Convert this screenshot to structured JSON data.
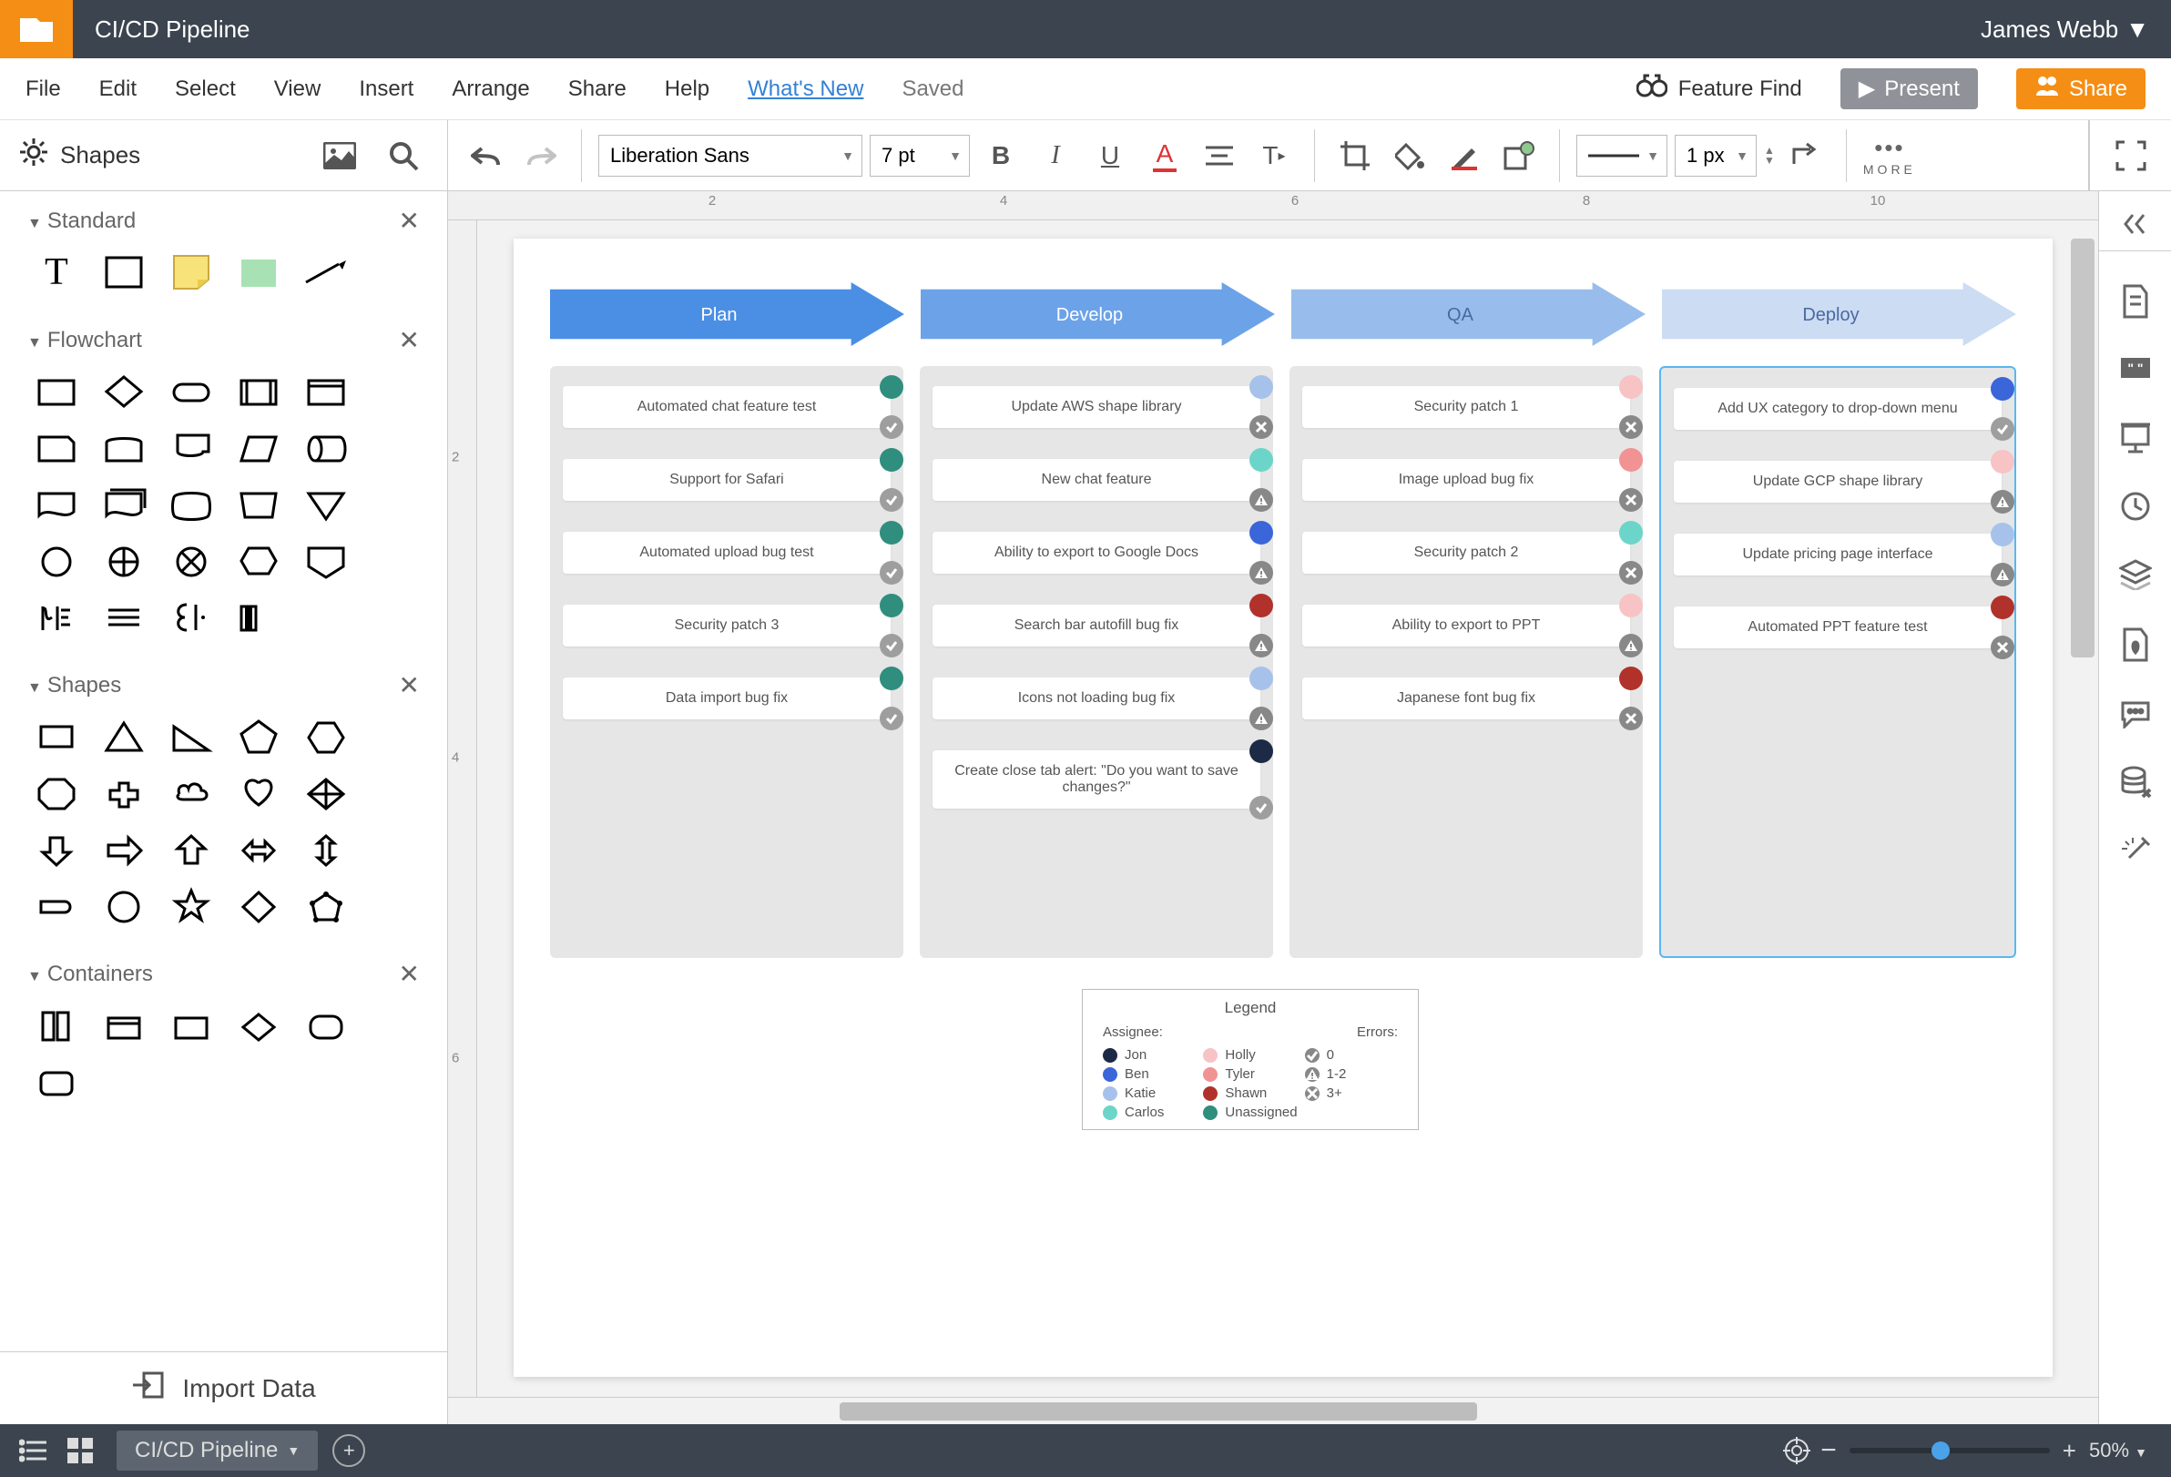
{
  "topbar": {
    "title": "CI/CD Pipeline",
    "user": "James Webb"
  },
  "menu": {
    "file": "File",
    "edit": "Edit",
    "select": "Select",
    "view": "View",
    "insert": "Insert",
    "arrange": "Arrange",
    "share": "Share",
    "help": "Help",
    "whats_new": "What's New",
    "saved": "Saved",
    "feature_find": "Feature Find",
    "present": "Present",
    "share_btn": "Share"
  },
  "toolbar": {
    "shapes_label": "Shapes",
    "font": "Liberation Sans",
    "font_size": "7 pt",
    "line_width": "1 px",
    "more": "MORE"
  },
  "sidebar": {
    "standard": "Standard",
    "flowchart": "Flowchart",
    "shapes": "Shapes",
    "containers": "Containers",
    "import_data": "Import Data"
  },
  "kanban": {
    "stages": [
      "Plan",
      "Develop",
      "QA",
      "Deploy"
    ],
    "columns": [
      {
        "cards": [
          {
            "t": "Automated chat feature test",
            "a": "c-teal",
            "s": "check"
          },
          {
            "t": "Support for Safari",
            "a": "c-teal",
            "s": "check"
          },
          {
            "t": "Automated upload bug test",
            "a": "c-teal",
            "s": "check"
          },
          {
            "t": "Security patch 3",
            "a": "c-teal",
            "s": "check"
          },
          {
            "t": "Data import bug fix",
            "a": "c-teal",
            "s": "check"
          }
        ]
      },
      {
        "cards": [
          {
            "t": "Update AWS shape library",
            "a": "c-lblue",
            "s": "x"
          },
          {
            "t": "New chat feature",
            "a": "c-aqua",
            "s": "warn"
          },
          {
            "t": "Ability to export to Google Docs",
            "a": "c-blue",
            "s": "warn"
          },
          {
            "t": "Search bar autofill bug fix",
            "a": "c-dred",
            "s": "warn"
          },
          {
            "t": "Icons not loading bug fix",
            "a": "c-lblue",
            "s": "warn"
          },
          {
            "t": "Create close tab alert: \"Do you want to save changes?\"",
            "a": "c-navy",
            "s": "check"
          }
        ]
      },
      {
        "cards": [
          {
            "t": "Security patch 1",
            "a": "c-pink",
            "s": "x"
          },
          {
            "t": "Image upload bug fix",
            "a": "c-coral",
            "s": "x"
          },
          {
            "t": "Security patch 2",
            "a": "c-aqua",
            "s": "x"
          },
          {
            "t": "Ability to export to PPT",
            "a": "c-pink",
            "s": "warn"
          },
          {
            "t": "Japanese font bug fix",
            "a": "c-dred",
            "s": "x"
          }
        ]
      },
      {
        "cards": [
          {
            "t": "Add UX category to drop-down menu",
            "a": "c-blue",
            "s": "check"
          },
          {
            "t": "Update GCP shape library",
            "a": "c-pink",
            "s": "warn"
          },
          {
            "t": "Update pricing page interface",
            "a": "c-lblue",
            "s": "warn"
          },
          {
            "t": "Automated PPT feature test",
            "a": "c-dred",
            "s": "x"
          }
        ]
      }
    ]
  },
  "legend": {
    "title": "Legend",
    "assignee_hdr": "Assignee:",
    "errors_hdr": "Errors:",
    "items_a": [
      [
        "c-navy",
        "Jon"
      ],
      [
        "c-blue",
        "Ben"
      ],
      [
        "c-lblue",
        "Katie"
      ],
      [
        "c-aqua",
        "Carlos"
      ]
    ],
    "items_b": [
      [
        "c-pink",
        "Holly"
      ],
      [
        "c-coral",
        "Tyler"
      ],
      [
        "c-dred",
        "Shawn"
      ],
      [
        "c-teal",
        "Unassigned"
      ]
    ],
    "errors": [
      [
        "check",
        "0"
      ],
      [
        "warn",
        "1-2"
      ],
      [
        "x",
        "3+"
      ]
    ]
  },
  "bottom": {
    "tab": "CI/CD Pipeline",
    "zoom": "50%"
  },
  "ruler_h": [
    "2",
    "4",
    "6",
    "8",
    "10"
  ],
  "ruler_v": [
    "2",
    "4",
    "6"
  ]
}
